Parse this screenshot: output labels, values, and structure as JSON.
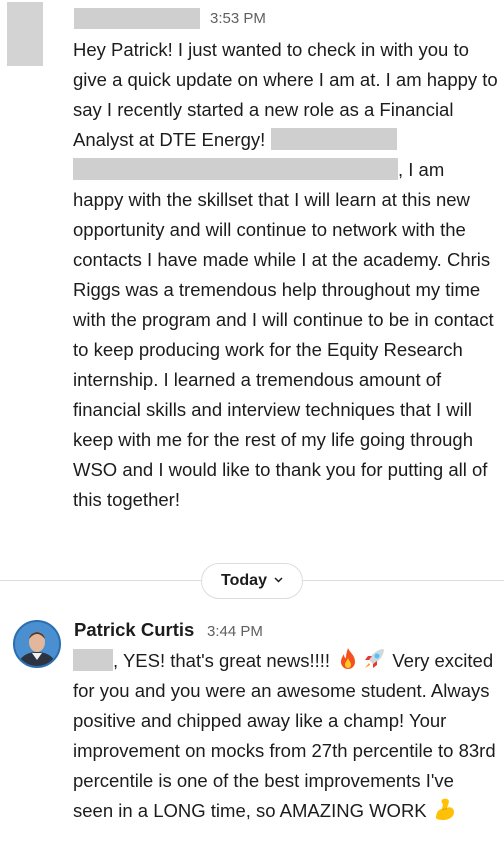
{
  "message_1": {
    "time": "3:53 PM",
    "text_part_1": "Hey Patrick! I just wanted to check in with you to give a quick update on where I am at. I am happy to say I recently started a new role as a Financial Analyst at DTE Energy!",
    "text_part_2": ", I am happy with the skillset that I will learn at this new opportunity and will continue to network with the contacts I have made while I at the academy. Chris Riggs was a tremendous help throughout my time with the program and I will continue to be in contact to keep producing work for the Equity Research internship. I learned a tremendous amount of financial skills and interview techniques that I will keep with me for the rest of my life going through WSO and I would like to thank you for putting all of this together!"
  },
  "divider": {
    "label": "Today",
    "chevron_icon": "chevron-down-icon"
  },
  "message_2": {
    "sender": "Patrick Curtis",
    "time": "3:44 PM",
    "text_part_1": ", YES!  that's great news!!!! ",
    "text_part_2": " Very excited for you and you were an awesome student.  Always positive and chipped away like a champ! Your improvement on mocks from 27th percentile to 83rd percentile is one of the best improvements I've seen in a LONG time, so AMAZING WORK ",
    "emojis": [
      "fire-emoji",
      "rocket-emoji",
      "flexed-biceps-emoji"
    ]
  },
  "colors": {
    "text": "#1d1c1d",
    "timestamp": "#616061",
    "redaction": "#cfcfcf",
    "divider": "#dddddd",
    "avatar_ring": "#2a6fb3"
  }
}
